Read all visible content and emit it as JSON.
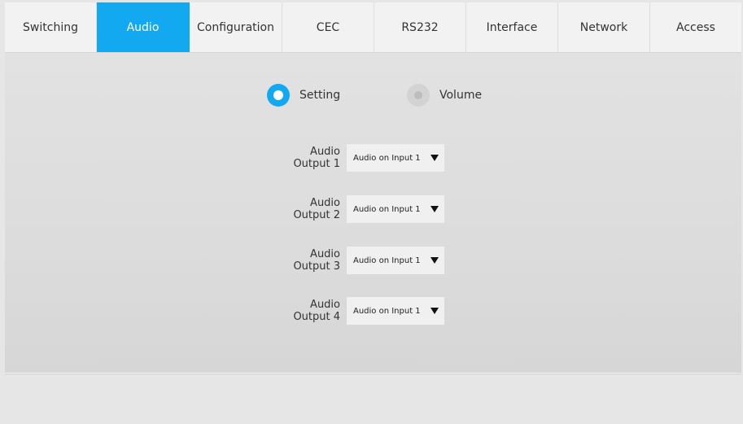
{
  "tabs": [
    {
      "label": "Switching",
      "active": false
    },
    {
      "label": "Audio",
      "active": true
    },
    {
      "label": "Configuration",
      "active": false
    },
    {
      "label": "CEC",
      "active": false
    },
    {
      "label": "RS232",
      "active": false
    },
    {
      "label": "Interface",
      "active": false
    },
    {
      "label": "Network",
      "active": false
    },
    {
      "label": "Access",
      "active": false
    }
  ],
  "mode": {
    "setting_label": "Setting",
    "volume_label": "Volume",
    "selected": "Setting"
  },
  "outputs": [
    {
      "label_line1": "Audio",
      "label_line2": "Output 1",
      "value": "Audio on Input 1"
    },
    {
      "label_line1": "Audio",
      "label_line2": "Output 2",
      "value": "Audio on Input 1"
    },
    {
      "label_line1": "Audio",
      "label_line2": "Output 3",
      "value": "Audio on Input 1"
    },
    {
      "label_line1": "Audio",
      "label_line2": "Output 4",
      "value": "Audio on Input 1"
    }
  ],
  "colors": {
    "accent": "#12a9f0",
    "tab_bar": "#f2f2f2",
    "panel": "#dcdcdc"
  },
  "icons": {
    "dropdown": "triangle-down-icon",
    "radio_selected": "radio-selected-icon",
    "radio_unselected": "radio-unselected-icon"
  }
}
